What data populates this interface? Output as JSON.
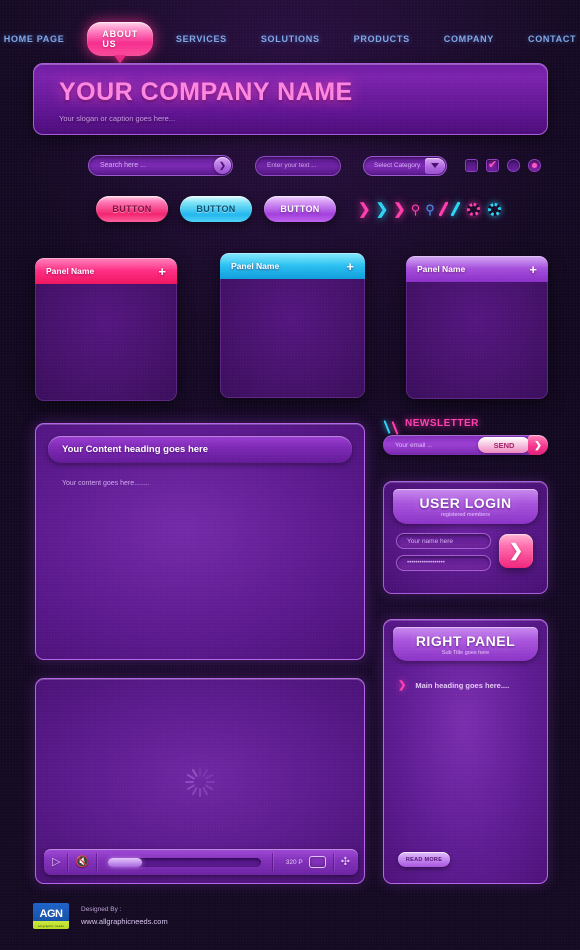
{
  "nav": {
    "items": [
      {
        "label": "HOME PAGE",
        "active": false
      },
      {
        "label": "ABOUT US",
        "active": true
      },
      {
        "label": "SERVICES",
        "active": false
      },
      {
        "label": "SOLUTIONS",
        "active": false
      },
      {
        "label": "PRODUCTS",
        "active": false
      },
      {
        "label": "COMPANY",
        "active": false
      },
      {
        "label": "CONTACT",
        "active": false
      }
    ]
  },
  "banner": {
    "title": "YOUR COMPANY NAME",
    "subtitle": "Your slogan or caption goes here..."
  },
  "form_row": {
    "search_placeholder": "Search here ...",
    "search_go_icon": "chevron-right-icon",
    "text_placeholder": "Enter your text  ...",
    "select_value": "Select Category",
    "select_icon": "chevron-down-icon",
    "checkbox_unchecked_label": "",
    "checkbox_checked_label": "✔",
    "radio_off_label": "",
    "radio_on_label": ""
  },
  "buttons": {
    "pink": "BUTTON",
    "cyan": "BUTTON",
    "purple": "BUTTON"
  },
  "icon_row": {
    "items": [
      {
        "name": "chevron-right-icon",
        "glyph": "❯",
        "color": "#ff3fae"
      },
      {
        "name": "chevron-right-icon",
        "glyph": "❯",
        "color": "#2fd3f5"
      },
      {
        "name": "chevron-right-icon",
        "glyph": "❯",
        "color": "#ff3fae"
      },
      {
        "name": "search-icon",
        "glyph": "🔍",
        "color": "#ff3fae"
      },
      {
        "name": "search-icon",
        "glyph": "🔍",
        "color": "#5b8cf5"
      },
      {
        "name": "slash-icon",
        "glyph": "",
        "color": "#ff3fae"
      },
      {
        "name": "slash-icon",
        "glyph": "",
        "color": "#2fd3f5"
      },
      {
        "name": "gear-icon",
        "glyph": "",
        "color": "#ff3fae"
      },
      {
        "name": "gear-icon",
        "glyph": "",
        "color": "#2fd3f5"
      }
    ]
  },
  "panels": [
    {
      "title": "Panel Name",
      "plus": "+",
      "accent": "#f0155f",
      "accent_name": "pink"
    },
    {
      "title": "Panel Name",
      "plus": "+",
      "accent": "#0f9ddd",
      "accent_name": "blue"
    },
    {
      "title": "Panel Name",
      "plus": "+",
      "accent": "#8b2fc8",
      "accent_name": "violet"
    }
  ],
  "content": {
    "heading": "Your Content heading goes here",
    "body": "Your content goes here........"
  },
  "video": {
    "play_icon": "play-icon",
    "mute_icon": "speaker-mute-icon",
    "quality": "320 P",
    "screen_icon": "screen-icon",
    "fullscreen_icon": "expand-arrows-icon",
    "progress_percent": 22,
    "loading_icon": "spinner-icon"
  },
  "newsletter": {
    "title": "NEWSLETTER",
    "email_placeholder": "Your email ...",
    "send_label": "SEND",
    "go_icon": "chevron-right-icon"
  },
  "login": {
    "title": "USER LOGIN",
    "subtitle": "registered members",
    "name_placeholder": "Your name here",
    "password_value": "••••••••••••••••••",
    "go_icon": "chevron-right-icon"
  },
  "right_panel": {
    "title": "RIGHT PANEL",
    "subtitle": "Sub Title goes here",
    "arrow_icon": "chevron-right-icon",
    "heading": "Main heading goes here....",
    "read_more": "READ MORE"
  },
  "footer": {
    "logo_text": "AGN",
    "logo_sub": "all graphic needs",
    "designed_by": "Designed By :",
    "website": "www.allgraphicneeds.com"
  },
  "colors": {
    "background": "#140a22",
    "accent_pink": "#ff3fae",
    "accent_cyan": "#2fd3f5",
    "accent_purple": "#a854dd",
    "nav_text": "#7fa8e8"
  }
}
